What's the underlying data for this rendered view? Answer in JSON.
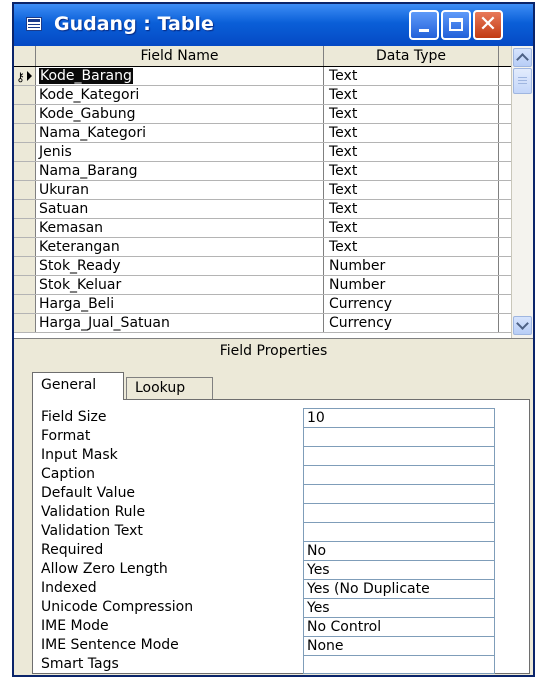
{
  "window": {
    "title": "Gudang : Table",
    "icon": "table-icon",
    "controls": [
      "minimize-icon",
      "maximize-icon",
      "close-icon"
    ],
    "close_glyph": "✕"
  },
  "grid": {
    "headers": {
      "field_name": "Field Name",
      "data_type": "Data Type"
    },
    "rows": [
      {
        "name": "Kode_Barang",
        "type": "Text",
        "primary_key": true,
        "current": true
      },
      {
        "name": "Kode_Kategori",
        "type": "Text"
      },
      {
        "name": "Kode_Gabung",
        "type": "Text"
      },
      {
        "name": "Nama_Kategori",
        "type": "Text"
      },
      {
        "name": "Jenis",
        "type": "Text"
      },
      {
        "name": "Nama_Barang",
        "type": "Text"
      },
      {
        "name": "Ukuran",
        "type": "Text"
      },
      {
        "name": "Satuan",
        "type": "Text"
      },
      {
        "name": "Kemasan",
        "type": "Text"
      },
      {
        "name": "Keterangan",
        "type": "Text"
      },
      {
        "name": "Stok_Ready",
        "type": "Number"
      },
      {
        "name": "Stok_Keluar",
        "type": "Number"
      },
      {
        "name": "Harga_Beli",
        "type": "Currency"
      },
      {
        "name": "Harga_Jual_Satuan",
        "type": "Currency"
      }
    ]
  },
  "field_properties": {
    "heading": "Field Properties",
    "tabs": [
      "General",
      "Lookup"
    ],
    "active_tab": "General",
    "properties": [
      {
        "label": "Field Size",
        "value": "10"
      },
      {
        "label": "Format",
        "value": ""
      },
      {
        "label": "Input Mask",
        "value": ""
      },
      {
        "label": "Caption",
        "value": ""
      },
      {
        "label": "Default Value",
        "value": ""
      },
      {
        "label": "Validation Rule",
        "value": ""
      },
      {
        "label": "Validation Text",
        "value": ""
      },
      {
        "label": "Required",
        "value": "No"
      },
      {
        "label": "Allow Zero Length",
        "value": "Yes"
      },
      {
        "label": "Indexed",
        "value": "Yes (No Duplicate"
      },
      {
        "label": "Unicode Compression",
        "value": "Yes"
      },
      {
        "label": "IME Mode",
        "value": "No Control"
      },
      {
        "label": "IME Sentence Mode",
        "value": "None"
      },
      {
        "label": "Smart Tags",
        "value": ""
      }
    ]
  },
  "colors": {
    "titlebar": "#0a5fd8",
    "close_button": "#c23b13",
    "panel": "#ece9d8"
  }
}
